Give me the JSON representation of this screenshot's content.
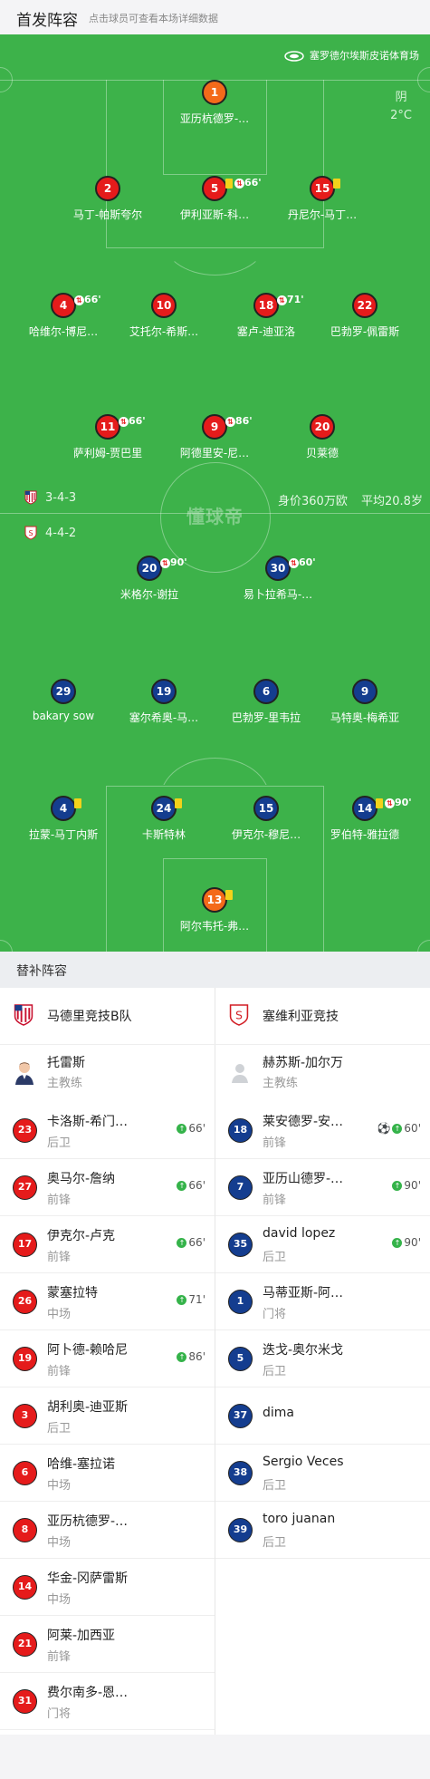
{
  "header": {
    "title": "首发阵容",
    "subtitle": "点击球员可查看本场详细数据"
  },
  "pitch": {
    "venue": "塞罗德尔埃斯皮诺体育场",
    "weather": "阴",
    "temperature": "2°C",
    "watermark": "懂球帝",
    "home_formation": "3-4-3",
    "away_formation": "4-4-2",
    "market_value": "身价360万欧",
    "avg_age": "平均20.8岁"
  },
  "home_players": [
    {
      "num": "1",
      "name": "亚历杭德罗-…",
      "color": "orange"
    },
    {
      "num": "2",
      "name": "马丁-帕斯夸尔",
      "color": "red"
    },
    {
      "num": "5",
      "name": "伊利亚斯-科…",
      "color": "red",
      "event": "66'",
      "yellow": true,
      "sub": true
    },
    {
      "num": "15",
      "name": "丹尼尔-马丁…",
      "color": "red",
      "yellow": true
    },
    {
      "num": "4",
      "name": "哈维尔-博尼…",
      "color": "red",
      "event": "66'",
      "sub": true
    },
    {
      "num": "10",
      "name": "艾托尔-希斯…",
      "color": "red"
    },
    {
      "num": "18",
      "name": "塞卢-迪亚洛",
      "color": "red",
      "event": "71'",
      "sub": true
    },
    {
      "num": "22",
      "name": "巴勃罗-佩雷斯",
      "color": "red"
    },
    {
      "num": "11",
      "name": "萨利姆-贾巴里",
      "color": "red",
      "event": "66'",
      "sub": true
    },
    {
      "num": "9",
      "name": "阿德里安-尼…",
      "color": "red",
      "event": "86'",
      "sub": true
    },
    {
      "num": "20",
      "name": "贝莱德",
      "color": "red"
    }
  ],
  "away_players": [
    {
      "num": "20",
      "name": "米格尔-谢拉",
      "color": "blue",
      "event": "90'",
      "sub": true
    },
    {
      "num": "30",
      "name": "易卜拉希马-…",
      "color": "blue",
      "event": "60'",
      "sub": true
    },
    {
      "num": "29",
      "name": "bakary sow",
      "color": "blue"
    },
    {
      "num": "19",
      "name": "塞尔希奥-马…",
      "color": "blue"
    },
    {
      "num": "6",
      "name": "巴勃罗-里韦拉",
      "color": "blue"
    },
    {
      "num": "9",
      "name": "马特奥-梅希亚",
      "color": "blue"
    },
    {
      "num": "4",
      "name": "拉蒙-马丁内斯",
      "color": "blue",
      "yellow": true
    },
    {
      "num": "24",
      "name": "卡斯特林",
      "color": "blue",
      "yellow": true
    },
    {
      "num": "15",
      "name": "伊克尔-穆尼…",
      "color": "blue"
    },
    {
      "num": "14",
      "name": "罗伯特-雅拉德",
      "color": "blue",
      "event": "90'",
      "yellow": true,
      "sub": true
    },
    {
      "num": "13",
      "name": "阿尔韦托-弗…",
      "color": "orange",
      "yellow": true
    }
  ],
  "subs_title": "替补阵容",
  "home_team": {
    "name": "马德里竞技B队",
    "coach_name": "托雷斯",
    "coach_role": "主教练",
    "subs": [
      {
        "num": "23",
        "name": "卡洛斯-希门…",
        "pos": "后卫",
        "event": "66'"
      },
      {
        "num": "27",
        "name": "奥马尔-詹纳",
        "pos": "前锋",
        "event": "66'"
      },
      {
        "num": "17",
        "name": "伊克尔-卢克",
        "pos": "前锋",
        "event": "66'"
      },
      {
        "num": "26",
        "name": "蒙塞拉特",
        "pos": "中场",
        "event": "71'"
      },
      {
        "num": "19",
        "name": "阿卜德-赖哈尼",
        "pos": "前锋",
        "event": "86'"
      },
      {
        "num": "3",
        "name": "胡利奥-迪亚斯",
        "pos": "后卫",
        "event": ""
      },
      {
        "num": "6",
        "name": "哈维-塞拉诺",
        "pos": "中场",
        "event": ""
      },
      {
        "num": "8",
        "name": "亚历杭德罗-…",
        "pos": "中场",
        "event": ""
      },
      {
        "num": "14",
        "name": "华金-冈萨雷斯",
        "pos": "中场",
        "event": ""
      },
      {
        "num": "21",
        "name": "阿莱-加西亚",
        "pos": "前锋",
        "event": ""
      },
      {
        "num": "31",
        "name": "费尔南多-恩…",
        "pos": "门将",
        "event": ""
      }
    ]
  },
  "away_team": {
    "name": "塞维利亚竞技",
    "coach_name": "赫苏斯-加尔万",
    "coach_role": "主教练",
    "subs": [
      {
        "num": "18",
        "name": "莱安德罗-安…",
        "pos": "前锋",
        "event": "60'",
        "goal": true
      },
      {
        "num": "7",
        "name": "亚历山德罗-…",
        "pos": "前锋",
        "event": "90'"
      },
      {
        "num": "35",
        "name": "david lopez",
        "pos": "后卫",
        "event": "90'"
      },
      {
        "num": "1",
        "name": "马蒂亚斯-阿…",
        "pos": "门将",
        "event": ""
      },
      {
        "num": "5",
        "name": "迭戈-奥尔米戈",
        "pos": "后卫",
        "event": ""
      },
      {
        "num": "37",
        "name": "dima",
        "pos": "",
        "event": ""
      },
      {
        "num": "38",
        "name": "Sergio Veces",
        "pos": "后卫",
        "event": ""
      },
      {
        "num": "39",
        "name": "toro juanan",
        "pos": "后卫",
        "event": ""
      }
    ]
  }
}
